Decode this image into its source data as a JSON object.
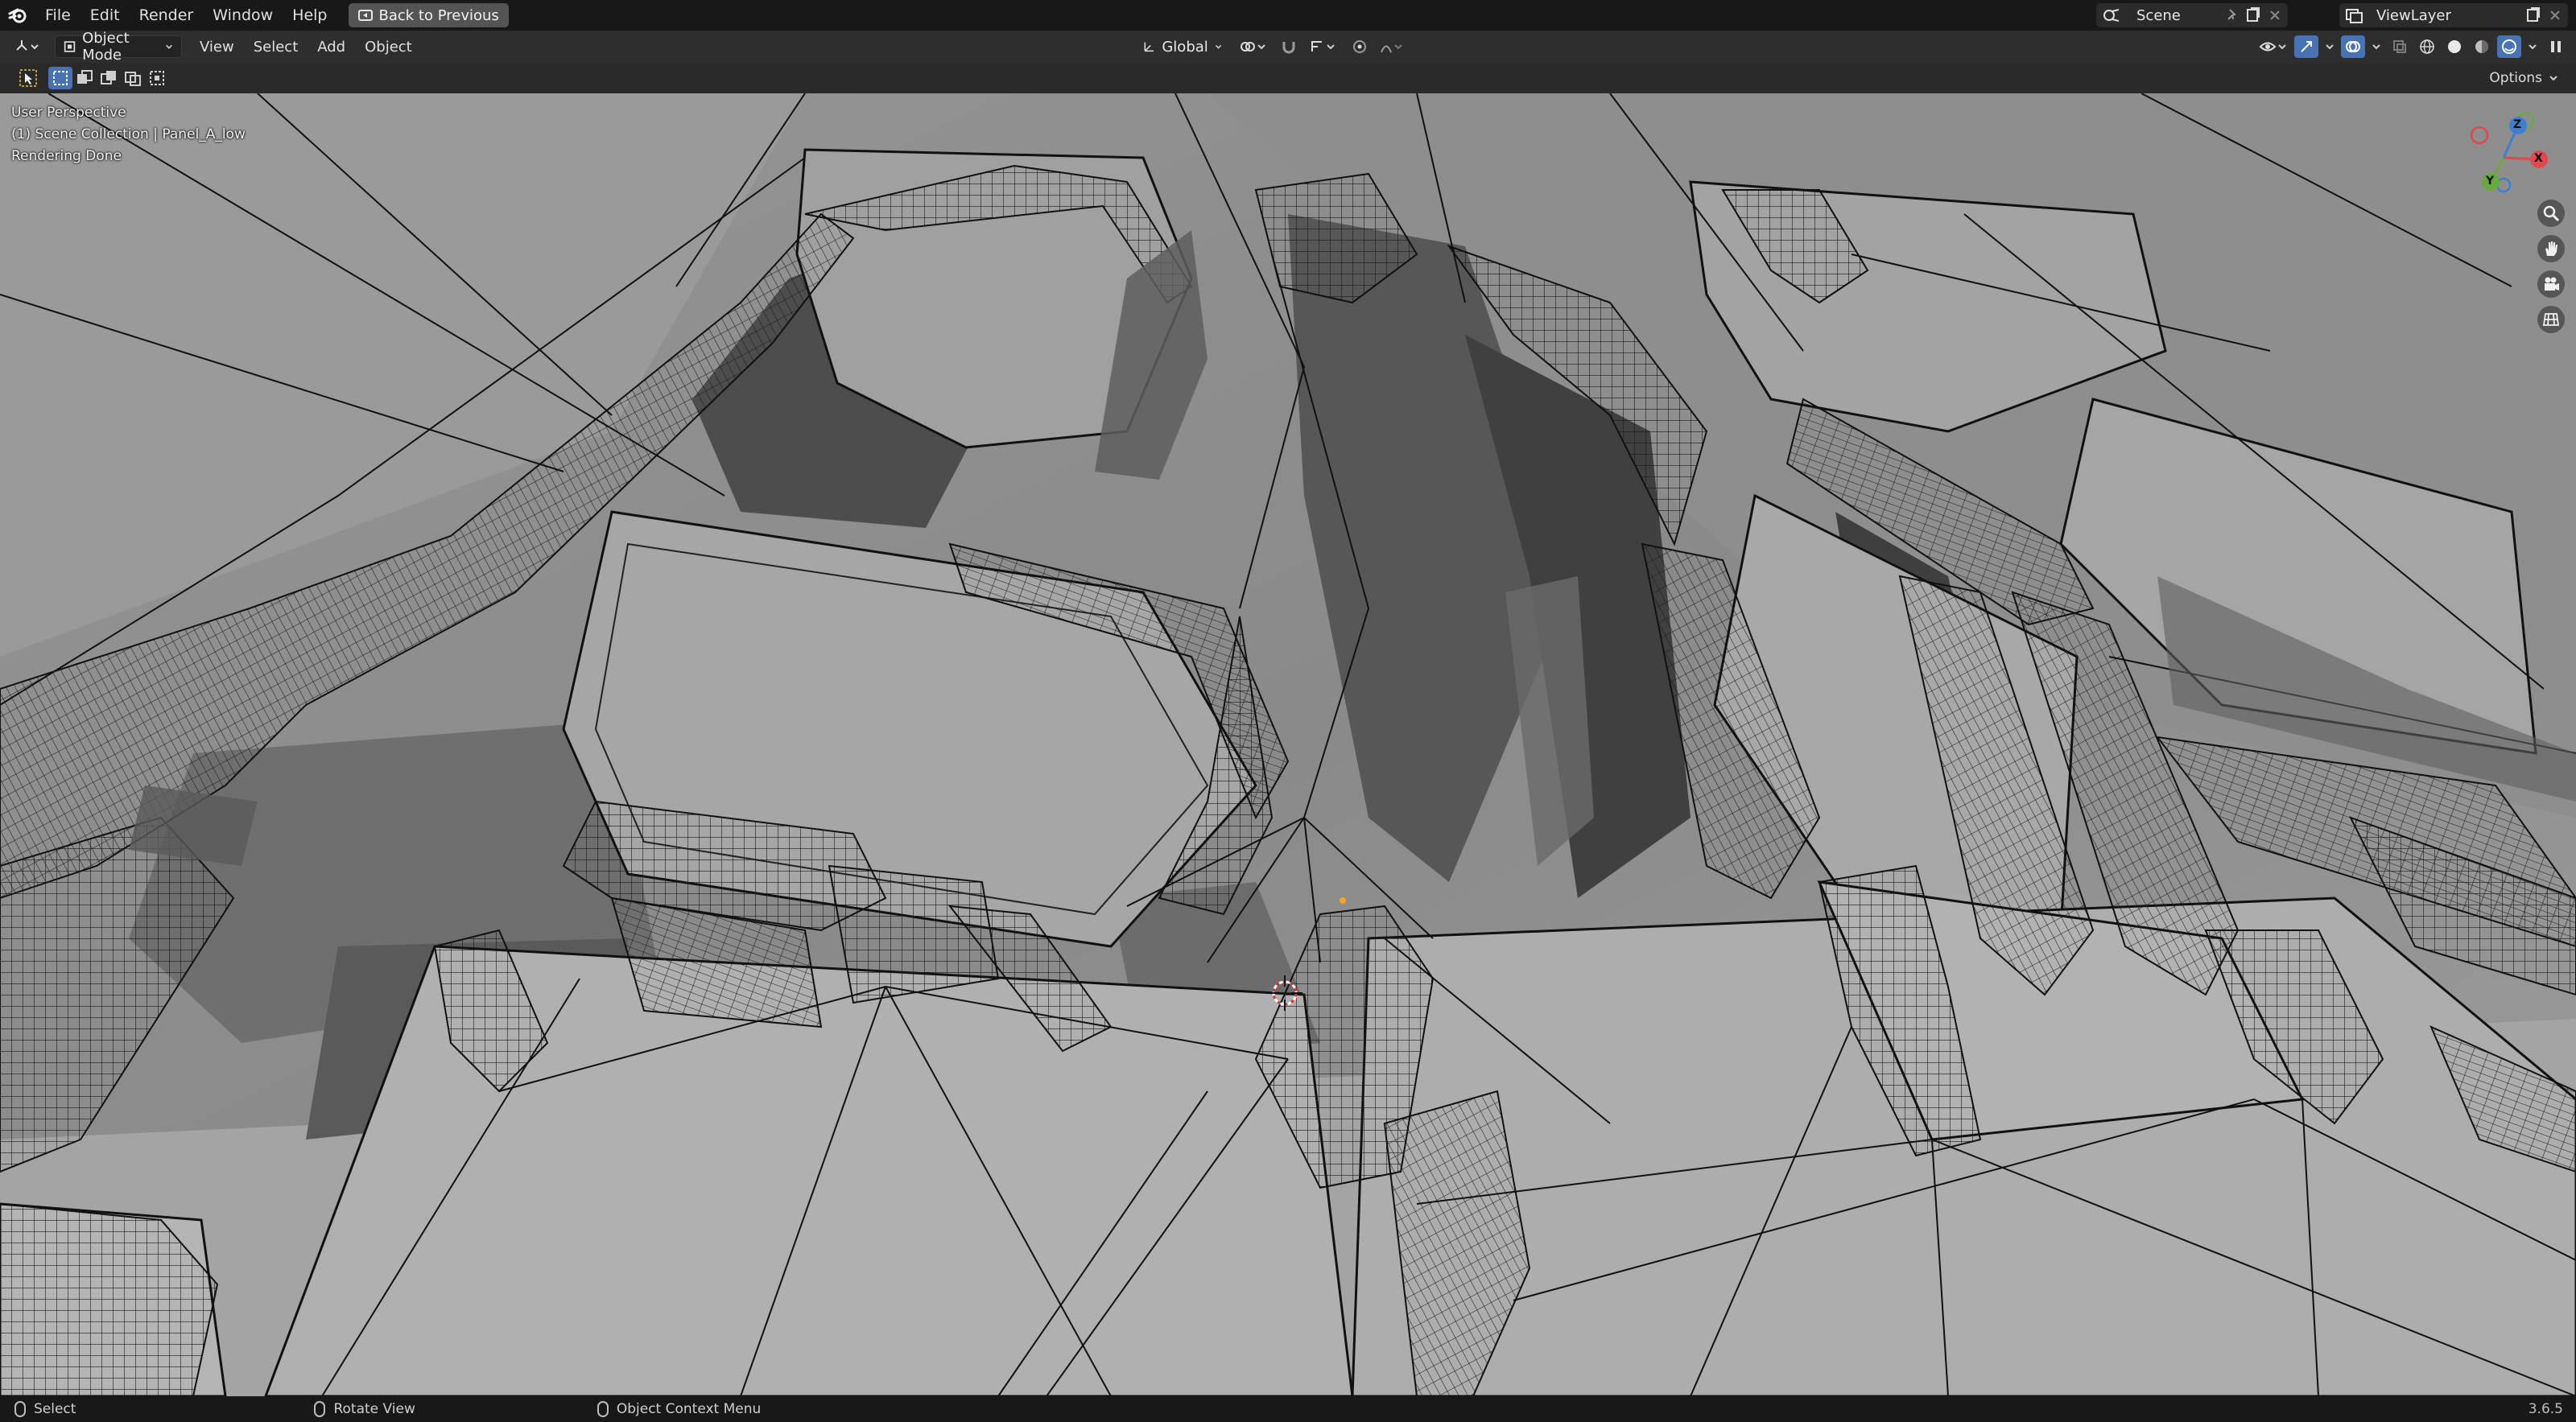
{
  "topbar": {
    "menus": [
      "File",
      "Edit",
      "Render",
      "Window",
      "Help"
    ],
    "back_button": "Back to Previous",
    "scene": "Scene",
    "view_layer": "ViewLayer"
  },
  "header": {
    "mode": "Object Mode",
    "menus": [
      "View",
      "Select",
      "Add",
      "Object"
    ],
    "transform_orientation": "Global"
  },
  "toolrow": {
    "options": "Options"
  },
  "viewport": {
    "perspective": "User Perspective",
    "collection": "(1) Scene Collection | Panel_A_low",
    "status": "Rendering Done",
    "gizmo": {
      "x": "X",
      "y": "Y",
      "z": "Z"
    },
    "colors": {
      "x_axis": "#e0474f",
      "y_axis": "#6aa93d",
      "z_axis": "#3f7fd1",
      "background": "#7c7c7c"
    }
  },
  "statusbar": {
    "left_action": "Select",
    "middle_action": "Rotate View",
    "right_action": "Object Context Menu",
    "version": "3.6.5"
  }
}
